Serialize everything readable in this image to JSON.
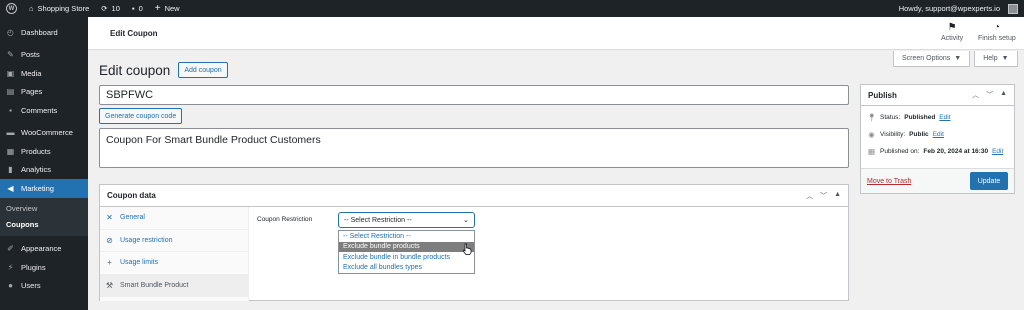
{
  "admin_bar": {
    "site_name": "Shopping Store",
    "updates_count": "10",
    "comments_count": "0",
    "new_label": "New",
    "howdy": "Howdy, support@wpexperts.io"
  },
  "sidebar": {
    "items": [
      {
        "label": "Dashboard",
        "icon": "dashboard-icon"
      },
      {
        "label": "Posts",
        "icon": "pin-icon"
      },
      {
        "label": "Media",
        "icon": "media-icon"
      },
      {
        "label": "Pages",
        "icon": "pages-icon"
      },
      {
        "label": "Comments",
        "icon": "comment-icon"
      },
      {
        "label": "WooCommerce",
        "icon": "woocommerce-icon"
      },
      {
        "label": "Products",
        "icon": "products-icon"
      },
      {
        "label": "Analytics",
        "icon": "analytics-icon"
      },
      {
        "label": "Marketing",
        "icon": "megaphone-icon"
      },
      {
        "label": "Appearance",
        "icon": "brush-icon"
      },
      {
        "label": "Plugins",
        "icon": "plugin-icon"
      },
      {
        "label": "Users",
        "icon": "user-icon"
      }
    ],
    "submenu": [
      "Overview",
      "Coupons"
    ]
  },
  "header": {
    "title": "Edit Coupon",
    "activity_label": "Activity",
    "finish_setup_label": "Finish setup"
  },
  "screen_options": {
    "screen_options_label": "Screen Options",
    "help_label": "Help"
  },
  "page": {
    "title": "Edit coupon",
    "add_coupon_label": "Add coupon",
    "coupon_code": "SBPFWC",
    "generate_label": "Generate coupon code",
    "description": "Coupon For Smart Bundle Product Customers"
  },
  "coupon_data": {
    "heading": "Coupon data",
    "tabs": [
      {
        "label": "General",
        "icon": "ticket-icon"
      },
      {
        "label": "Usage restriction",
        "icon": "block-icon"
      },
      {
        "label": "Usage limits",
        "icon": "plus-icon"
      },
      {
        "label": "Smart Bundle Product",
        "icon": "wrench-icon"
      }
    ],
    "restriction_label": "Coupon Restriction",
    "select_value": "-- Select Restriction --",
    "options": [
      "-- Select Restriction --",
      "Exclude bundle products",
      "Exclude bundle in bundle products",
      "Exclude all bundles types"
    ]
  },
  "publish": {
    "heading": "Publish",
    "status_label": "Status:",
    "status_value": "Published",
    "visibility_label": "Visibility:",
    "visibility_value": "Public",
    "published_label": "Published on:",
    "published_value": "Feb 20, 2024 at 16:30",
    "edit_label": "Edit",
    "trash_label": "Move to Trash",
    "update_label": "Update"
  },
  "colors": {
    "accent": "#2271b1",
    "admin_dark": "#1d2327",
    "trash": "#b32d2e"
  }
}
